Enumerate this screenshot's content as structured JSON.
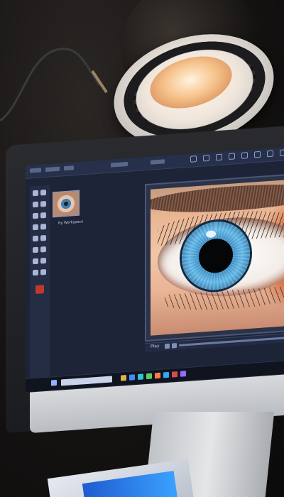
{
  "scene": {
    "description_elements": [
      "desk-lamp",
      "monitor",
      "photo-editor",
      "eye-image",
      "taskbar",
      "paper"
    ]
  },
  "editor": {
    "thumbnail_label": "Rу Workspace",
    "timeline_label": "Play"
  },
  "colors": {
    "screen_bg": "#1d2437",
    "iris_blue": "#5fb6e6",
    "accent_orange": "#e8722e"
  }
}
